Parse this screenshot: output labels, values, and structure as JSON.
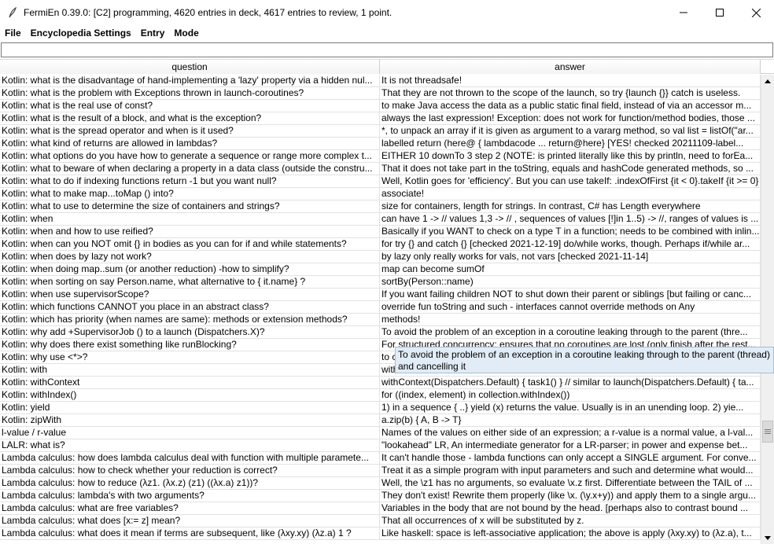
{
  "window": {
    "title": "FermiEn 0.39.0: [C2] programming, 4620 entries in deck, 4617 entries to review, 1 point.",
    "app_icon": "quill-icon"
  },
  "menu": [
    {
      "label": "File"
    },
    {
      "label": "Encyclopedia Settings"
    },
    {
      "label": "Entry"
    },
    {
      "label": "Mode"
    }
  ],
  "search": {
    "value": ""
  },
  "table": {
    "columns": {
      "question": "question",
      "answer": "answer"
    },
    "rows": [
      {
        "q": "Kotlin: what is the disadvantage of hand-implementing a 'lazy' property via a hidden nul...",
        "a": "It is not threadsafe!"
      },
      {
        "q": "Kotlin: what is the problem with Exceptions thrown in launch-coroutines?",
        "a": "That they are not thrown to the scope of the launch, so try {launch {}} catch is useless."
      },
      {
        "q": "Kotlin: what is the real use of const?",
        "a": "to make Java access the data as a public static final field, instead of via an accessor m..."
      },
      {
        "q": "Kotlin: what is the result of a block, and what is the exception?",
        "a": "always the last expression! Exception: does not work for function/method bodies, those ..."
      },
      {
        "q": "Kotlin: what is the spread operator and when is it used?",
        "a": "*, to unpack an array if it is given as argument to a vararg method, so  val list = listOf(\"ar..."
      },
      {
        "q": "Kotlin: what kind of returns are allowed in lambdas?",
        "a": "labelled return (here@ { lambdacode ... return@here} [YES! checked 20211109-label..."
      },
      {
        "q": "Kotlin: what options do you have how to generate a sequence or range more complex t...",
        "a": "EITHER 10 downTo 3 step 2 (NOTE: is printed literally like this by println, need to forEa..."
      },
      {
        "q": "Kotlin: what to beware of when declaring a property in a data class (outside the constru...",
        "a": "That it does not take part in the toString, equals and hashCode generated methods, so ..."
      },
      {
        "q": "Kotlin: what to do if indexing functions return -1 but you want null?",
        "a": "Well, Kotlin goes for 'efficiency'. But you can use takeIf: .indexOfFirst {it < 0}.takeIf {it >= 0}"
      },
      {
        "q": "Kotlin: what to make map...toMap () into?",
        "a": "associate!"
      },
      {
        "q": "Kotlin: what to use to determine the size of containers and strings?",
        "a": "size for containers, length for strings. In contrast, C# has Length everywhere"
      },
      {
        "q": "Kotlin: when",
        "a": "can have 1 -> // values 1,3 -> // , sequences of values [!]in 1..5) -> //, ranges of values is ..."
      },
      {
        "q": "Kotlin: when and how to use reified?",
        "a": "Basically if you WANT to check on a type T in a function; needs to be combined with inlin..."
      },
      {
        "q": "Kotlin: when can you NOT omit {} in bodies as you can for if and while statements?",
        "a": "for try {} and catch {} [checked 2021-12-19] do/while works, though. Perhaps if/while ar..."
      },
      {
        "q": "Kotlin: when does by lazy not work?",
        "a": "by lazy only really works for vals, not vars [checked 2021-11-14]"
      },
      {
        "q": "Kotlin: when doing map..sum (or another reduction) -how to simplify?",
        "a": "map can become sumOf"
      },
      {
        "q": "Kotlin: when sorting on say Person.name, what alternative to { it.name} ?",
        "a": "sortBy(Person::name)"
      },
      {
        "q": "Kotlin: when use supervisorScope?",
        "a": "If you want failing children NOT to shut down their parent or siblings [but failing or canc..."
      },
      {
        "q": "Kotlin: which functions CANNOT you place in an abstract class?",
        "a": "override fun toString and such - interfaces cannot override methods on Any"
      },
      {
        "q": "Kotlin: which has priority (when names are same): methods or extension methods?",
        "a": "methods!"
      },
      {
        "q": "Kotlin: why add +SupervisorJob () to a launch (Dispatchers.X)?",
        "a": "To avoid the problem of an exception in a coroutine leaking through to the parent (thre..."
      },
      {
        "q": "Kotlin: why does there exist something like runBlocking?",
        "a": "For structured concurrency: ensures that no coroutines are lost (only finish after the rest..."
      },
      {
        "q": "Kotlin: why use <*>?",
        "a": "to c"
      },
      {
        "q": "Kotlin: with",
        "a": "with"
      },
      {
        "q": "Kotlin: withContext",
        "a": "withContext(Dispatchers.Default) { task1() } // similar to launch(Dispatchers.Default) { ta..."
      },
      {
        "q": "Kotlin: withIndex()",
        "a": "for ((index, element) in collection.withIndex())"
      },
      {
        "q": "Kotlin: yield",
        "a": "1) in a sequence { ..} yield (x) returns the value. Usually is in an unending loop.     2) yie..."
      },
      {
        "q": "Kotlin: zipWith",
        "a": "a.zip(b) { A, B -> T}"
      },
      {
        "q": "l-value / r-value",
        "a": "Names of the values on either side of an expression; a r-value is a normal value, a l-val..."
      },
      {
        "q": "LALR: what is?",
        "a": "\"lookahead\" LR, An intermediate generator for a LR-parser; in power and expense bet..."
      },
      {
        "q": "Lambda calculus: how does lambda calculus deal with function with multiple paramete...",
        "a": "It can't handle those - lambda functions can only accept a SINGLE argument. For conve..."
      },
      {
        "q": "Lambda calculus: how to check whether your reduction is correct?",
        "a": "Treat it as a simple program with input parameters and such and determine what would..."
      },
      {
        "q": "Lambda calculus: how to reduce (λz1. (λx.z) (z1) ((λx.a) z1))?",
        "a": "Well, the \\z1 has no arguments, so evaluate \\x.z first. Differentiate between the TAIL of ..."
      },
      {
        "q": "Lambda calculus: lambda's with two arguments?",
        "a": "They don't exist! Rewrite them properly (like \\x. (\\y.x+y)) and apply them to a single argu..."
      },
      {
        "q": "Lambda calculus: what are free variables?",
        "a": "Variables in the body that are not bound by the head. [perhaps also to contrast bound ..."
      },
      {
        "q": "Lambda calculus: what does [x:= z] mean?",
        "a": "That all occurrences of x will be substituted by z."
      },
      {
        "q": "Lambda calculus: what does it mean if terms are subsequent, like (λxy.xy) (λz.a) 1 ?",
        "a": "Like haskell: space is left-associative application; the above is apply (λxy.xy) to (λz.a), t..."
      }
    ]
  },
  "tooltip": {
    "text": "To avoid the problem of an exception in a coroutine leaking through to the parent (thread) and cancelling it"
  }
}
